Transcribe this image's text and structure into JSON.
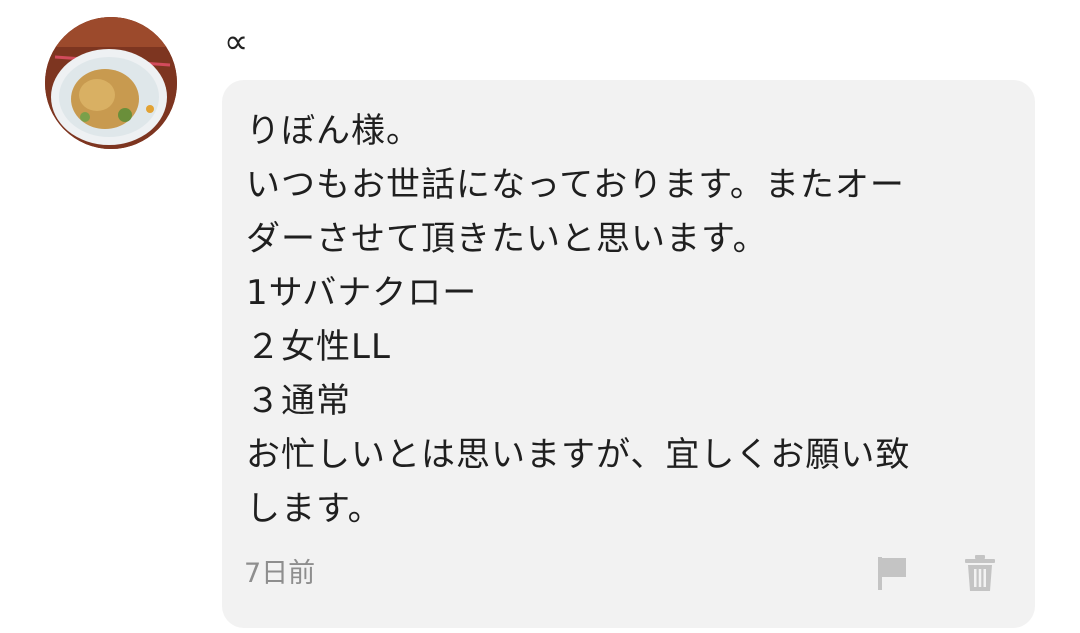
{
  "post": {
    "username": "∝",
    "timestamp": "7日前",
    "message_lines": [
      "りぼん様。",
      "いつもお世話になっております。またオー",
      "ダーさせて頂きたいと思います。",
      "1サバナクロー",
      "２女性LL",
      "３通常",
      "お忙しいとは思いますが、宜しくお願い致",
      "します。"
    ]
  },
  "icons": {
    "flag": "flag-icon",
    "trash": "trash-icon"
  },
  "colors": {
    "bubble_background": "#f2f2f2",
    "text": "#1f1f1f",
    "muted_text": "#8e8e8e",
    "icon_gray": "#c4c4c4"
  }
}
